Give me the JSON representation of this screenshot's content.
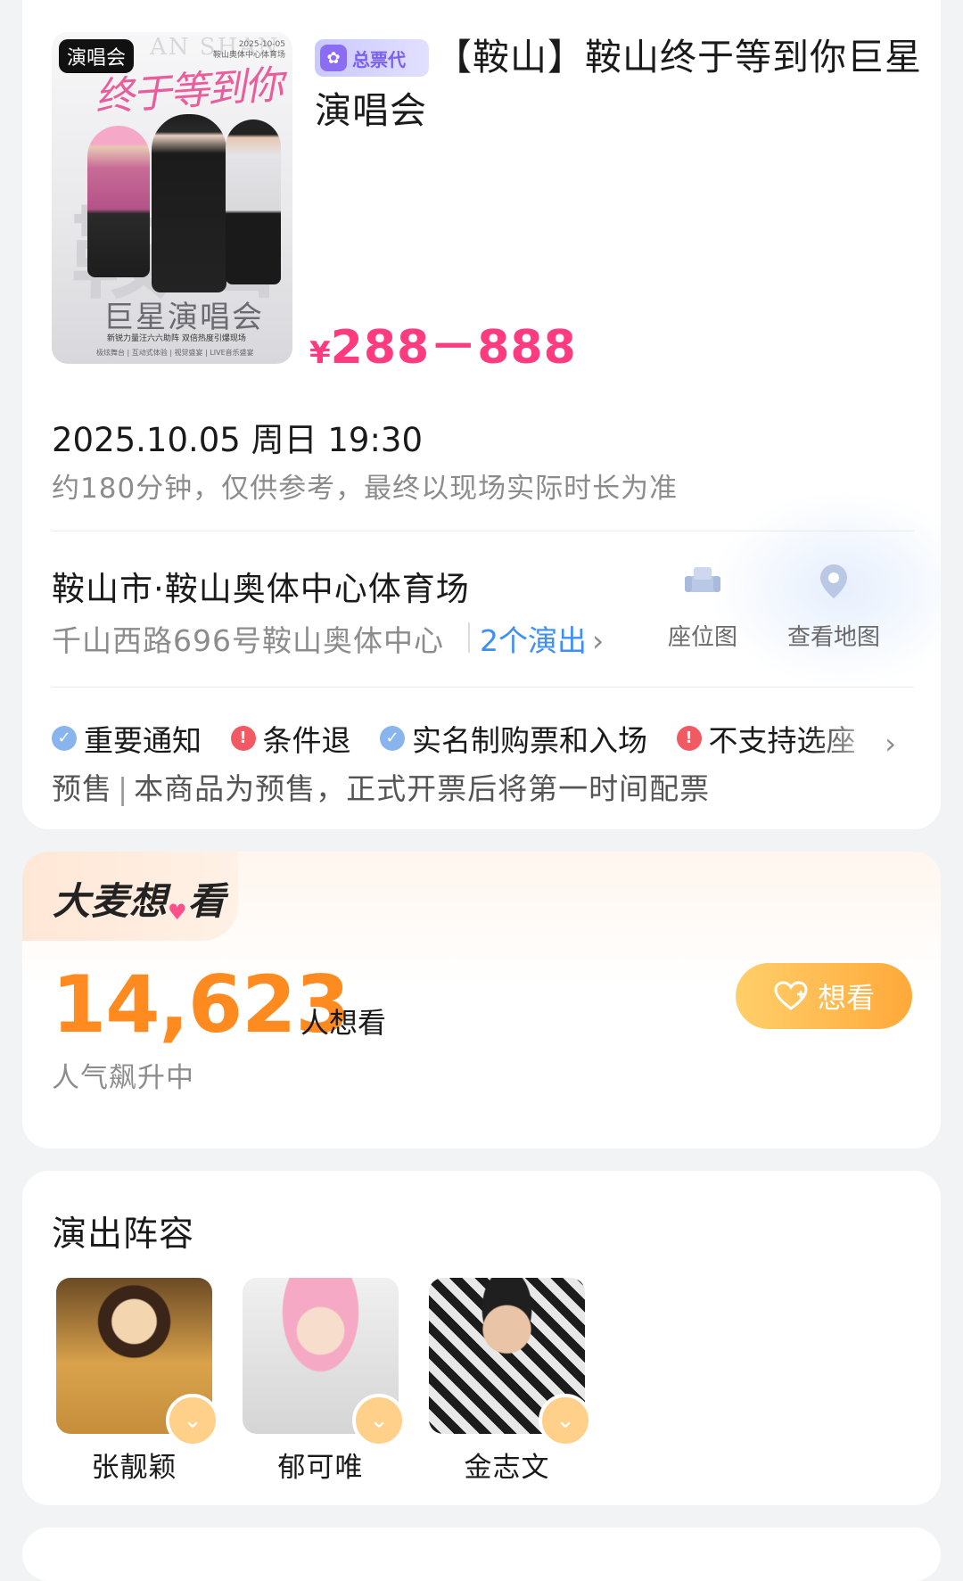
{
  "show": {
    "poster": {
      "tag": "演唱会",
      "en_title": "AN SHAN",
      "date": "2025-10-05",
      "venue_small": "鞍山奥体中心体育场",
      "title_art": "终于等到你",
      "bg_char": "鞍山",
      "subtitle": "巨星演唱会",
      "line": "新锐力量汪六六助阵 双倍热度引爆现场",
      "footer": "极炫舞台 | 互动式体验 | 视觉盛宴 | LIVE音乐盛宴"
    },
    "agent_badge": "总票代",
    "title": "【鞍山】鞍山终于等到你巨星演唱会",
    "price": {
      "currency": "¥",
      "range": "288－888"
    },
    "datetime": "2025.10.05 周日 19:30",
    "duration": "约180分钟，仅供参考，最终以现场实际时长为准",
    "venue": {
      "name": "鞍山市·鞍山奥体中心体育场",
      "address": "千山西路696号鞍山奥体中心",
      "shows_link": "2个演出",
      "seat_map": "座位图",
      "view_map": "查看地图"
    },
    "notices": [
      {
        "icon": "check-icon",
        "label": "重要通知",
        "color": "#89b5ee"
      },
      {
        "icon": "alert-icon",
        "label": "条件退",
        "color": "#f25a63"
      },
      {
        "icon": "check-icon",
        "label": "实名制购票和入场",
        "color": "#89b5ee"
      },
      {
        "icon": "alert-icon",
        "label": "不支持选座",
        "color": "#f25a63"
      }
    ],
    "presale": {
      "label": "预售",
      "separator": "|",
      "text": "本商品为预售，正式开票后将第一时间配票"
    }
  },
  "want": {
    "logo_a": "大麦想",
    "logo_b": "看",
    "count": "14,623",
    "unit": "人想看",
    "trend": "人气飙升中",
    "button": "想看"
  },
  "lineup": {
    "title": "演出阵容",
    "artists": [
      {
        "name": "张靓颖"
      },
      {
        "name": "郁可唯"
      },
      {
        "name": "金志文"
      }
    ]
  },
  "colors": {
    "price": "#ff3b7f",
    "count": "#ff8a1f",
    "link": "#3e8ff5",
    "button": "#ffa93a"
  }
}
